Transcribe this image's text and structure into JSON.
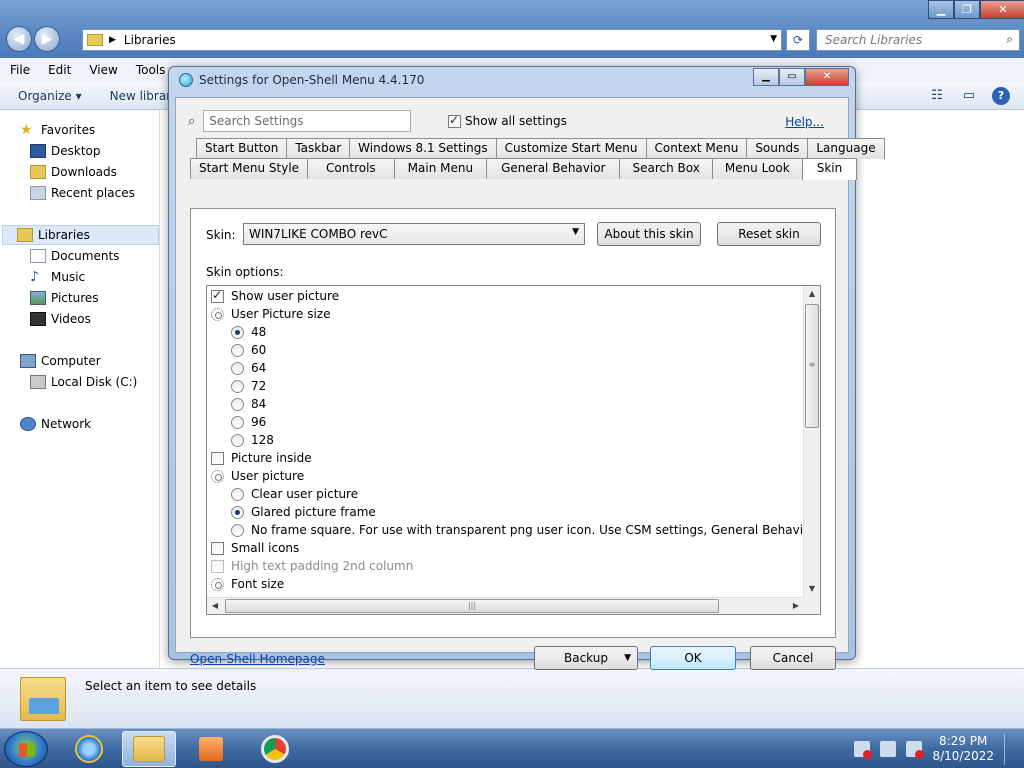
{
  "explorer": {
    "address": "Libraries",
    "search_placeholder": "Search Libraries",
    "menu": [
      "File",
      "Edit",
      "View",
      "Tools"
    ],
    "cmd": {
      "organize": "Organize ▾",
      "new_library": "New library"
    },
    "nav": {
      "favorites": "Favorites",
      "desktop": "Desktop",
      "downloads": "Downloads",
      "recent": "Recent places",
      "libraries": "Libraries",
      "documents": "Documents",
      "music": "Music",
      "pictures": "Pictures",
      "videos": "Videos",
      "computer": "Computer",
      "local_disk": "Local Disk (C:)",
      "network": "Network"
    },
    "details_msg": "Select an item to see details"
  },
  "dialog": {
    "title": "Settings for Open-Shell Menu 4.4.170",
    "search_placeholder": "Search Settings",
    "show_all": "Show all settings",
    "show_all_checked": true,
    "help": "Help...",
    "tabs_row1": [
      "Start Button",
      "Taskbar",
      "Windows 8.1 Settings",
      "Customize Start Menu",
      "Context Menu",
      "Sounds",
      "Language"
    ],
    "tabs_row2": [
      "Start Menu Style",
      "Controls",
      "Main Menu",
      "General Behavior",
      "Search Box",
      "Menu Look",
      "Skin"
    ],
    "selected_tab": "Skin",
    "skin_label": "Skin:",
    "skin_value": "WIN7LIKE COMBO revC",
    "about_skin": "About this skin",
    "reset_skin": "Reset skin",
    "options_label": "Skin options:",
    "options": [
      {
        "type": "check",
        "label": "Show user picture",
        "checked": true
      },
      {
        "type": "group",
        "label": "User Picture size"
      },
      {
        "type": "radio",
        "label": "48",
        "checked": true
      },
      {
        "type": "radio",
        "label": "60",
        "checked": false
      },
      {
        "type": "radio",
        "label": "64",
        "checked": false
      },
      {
        "type": "radio",
        "label": "72",
        "checked": false
      },
      {
        "type": "radio",
        "label": "84",
        "checked": false
      },
      {
        "type": "radio",
        "label": "96",
        "checked": false
      },
      {
        "type": "radio",
        "label": "128",
        "checked": false
      },
      {
        "type": "check",
        "label": "Picture inside",
        "checked": false
      },
      {
        "type": "group",
        "label": "User picture"
      },
      {
        "type": "radio",
        "label": "Clear user picture",
        "checked": false
      },
      {
        "type": "radio",
        "label": "Glared picture frame",
        "checked": true
      },
      {
        "type": "radio",
        "label": "No frame square. For use with transparent png user icon. Use CSM settings, General Behavior tab, User pi",
        "checked": false
      },
      {
        "type": "check",
        "label": "Small icons",
        "checked": false
      },
      {
        "type": "check",
        "label": "High text padding 2nd column",
        "checked": false,
        "disabled": true
      },
      {
        "type": "group",
        "label": "Font size"
      }
    ],
    "homepage": "Open-Shell Homepage",
    "backup": "Backup",
    "ok": "OK",
    "cancel": "Cancel"
  },
  "taskbar": {
    "time": "8:29 PM",
    "date": "8/10/2022"
  }
}
